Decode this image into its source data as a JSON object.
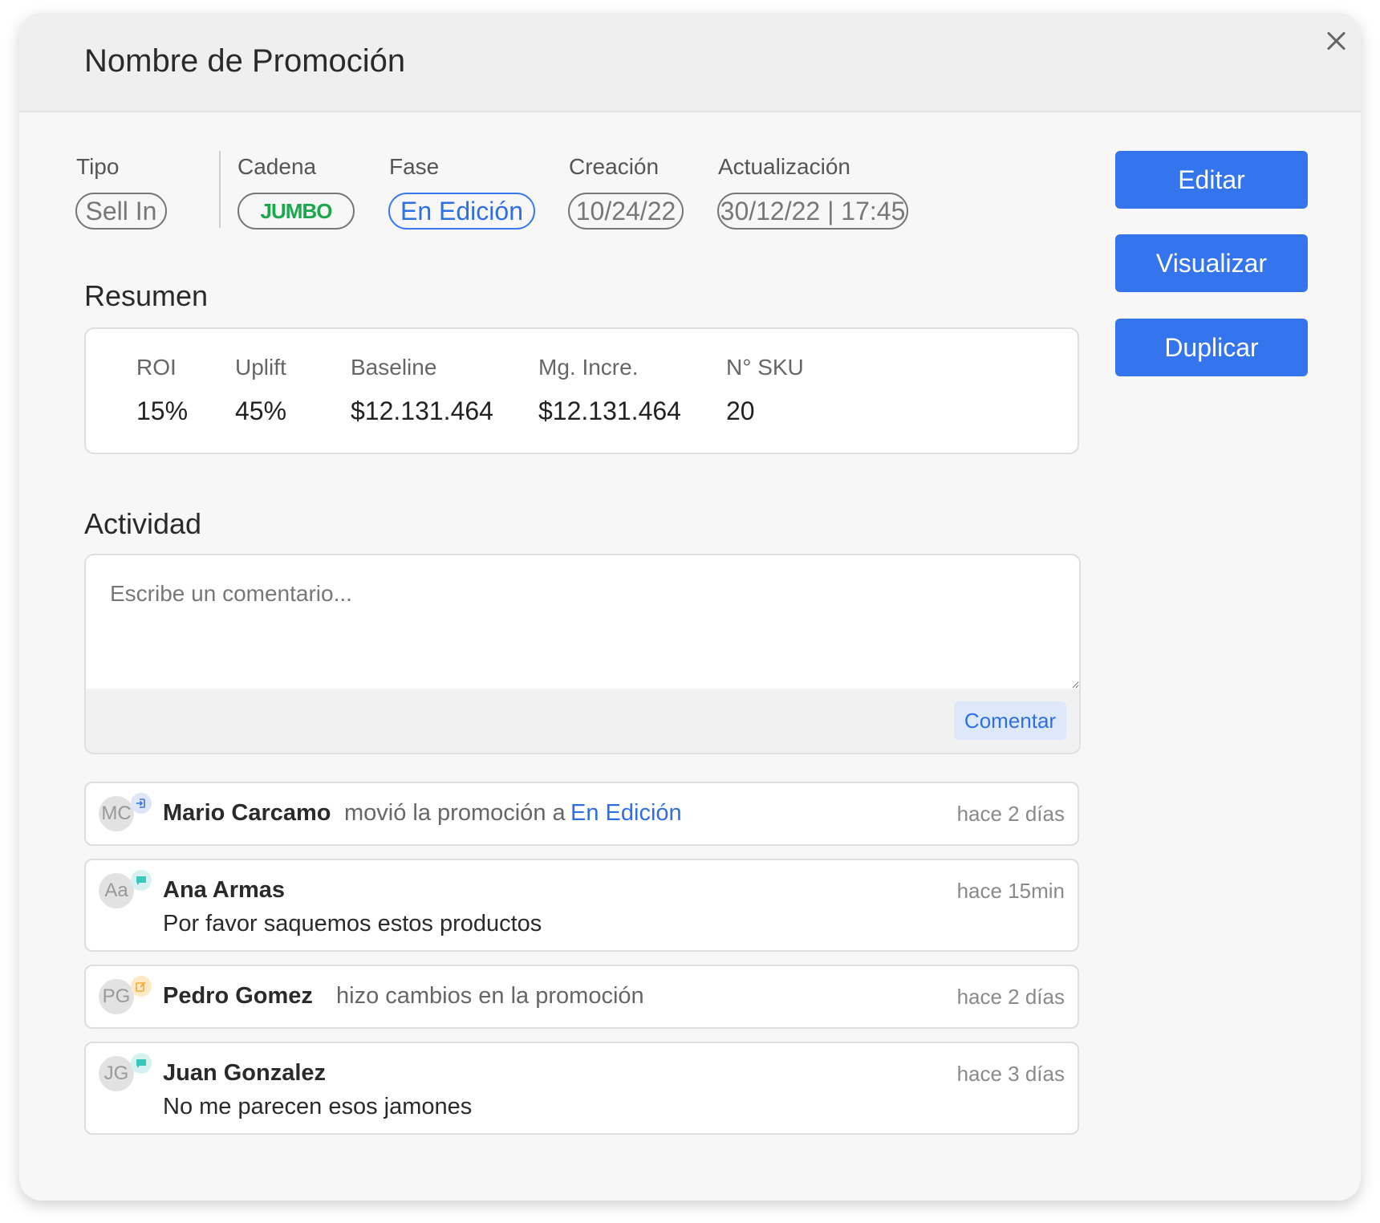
{
  "header": {
    "title": "Nombre de Promoción"
  },
  "meta": {
    "tipo": {
      "label": "Tipo",
      "value": "Sell In"
    },
    "cadena": {
      "label": "Cadena",
      "value": "JUMBO"
    },
    "fase": {
      "label": "Fase",
      "value": "En Edición"
    },
    "creacion": {
      "label": "Creación",
      "value": "10/24/22"
    },
    "actualizacion": {
      "label": "Actualización",
      "value": "30/12/22 | 17:45"
    }
  },
  "actions": {
    "edit": "Editar",
    "view": "Visualizar",
    "duplicate": "Duplicar"
  },
  "summary": {
    "title": "Resumen",
    "stats": [
      {
        "label": "ROI",
        "value": "15%"
      },
      {
        "label": "Uplift",
        "value": "45%"
      },
      {
        "label": "Baseline",
        "value": "$12.131.464"
      },
      {
        "label": "Mg. Incre.",
        "value": "$12.131.464"
      },
      {
        "label": "N° SKU",
        "value": "20"
      }
    ]
  },
  "activity": {
    "title": "Actividad",
    "placeholder": "Escribe un comentario...",
    "submit": "Comentar",
    "items": [
      {
        "initials": "MC",
        "name": "Mario Carcamo",
        "text": "movió la promoción a",
        "link": "En Edición",
        "time": "hace 2 días",
        "icon": "login-icon"
      },
      {
        "initials": "Aa",
        "name": "Ana Armas",
        "body": "Por favor saquemos estos productos",
        "time": "hace 15min",
        "icon": "chat-icon"
      },
      {
        "initials": "PG",
        "name": "Pedro Gomez",
        "text": "hizo cambios en la promoción",
        "time": "hace 2 días",
        "icon": "edit-icon"
      },
      {
        "initials": "JG",
        "name": "Juan Gonzalez",
        "body": "No me parecen esos jamones",
        "time": "hace 3 días",
        "icon": "chat-icon"
      }
    ]
  },
  "colors": {
    "primary": "#3475ee",
    "jumbo": "#1aa84a",
    "chat": "#3cc7bd",
    "edit": "#f3a93a"
  }
}
